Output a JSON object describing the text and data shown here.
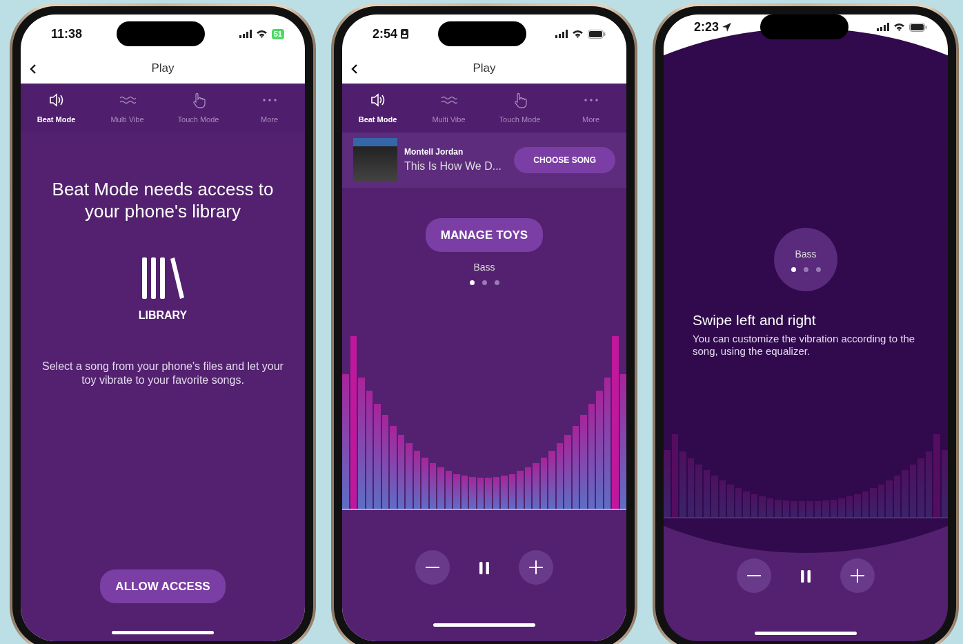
{
  "phones": [
    {
      "kind": "library-prompt",
      "status": {
        "time": "11:38",
        "battery": "51"
      },
      "nav": {
        "title": "Play"
      },
      "tabs": [
        {
          "label": "Beat Mode",
          "selected": true
        },
        {
          "label": "Multi Vibe",
          "selected": false
        },
        {
          "label": "Touch Mode",
          "selected": false
        },
        {
          "label": "More",
          "selected": false
        }
      ],
      "prompt": {
        "heading": "Beat Mode needs access to your phone's library",
        "icon_label": "LIBRARY",
        "text": "Select a song from your phone's files and let your toy vibrate to your favorite songs.",
        "button": "ALLOW ACCESS"
      }
    },
    {
      "kind": "player",
      "status": {
        "time": "2:54"
      },
      "nav": {
        "title": "Play"
      },
      "tabs": [
        {
          "label": "Beat Mode",
          "selected": true
        },
        {
          "label": "Multi Vibe",
          "selected": false
        },
        {
          "label": "Touch Mode",
          "selected": false
        },
        {
          "label": "More",
          "selected": false
        }
      ],
      "song": {
        "artist": "Montell Jordan",
        "title": "This Is How We D...",
        "button": "CHOOSE SONG"
      },
      "manage_button": "MANAGE TOYS",
      "preset": "Bass",
      "pages": [
        {
          "selected": true
        },
        {
          "selected": false
        },
        {
          "selected": false
        }
      ]
    },
    {
      "kind": "coach",
      "status": {
        "time": "2:23"
      },
      "preset": "Bass",
      "pages": [
        {
          "selected": true
        },
        {
          "selected": false
        },
        {
          "selected": false
        }
      ],
      "tip": {
        "title": "Swipe left and right",
        "text": "You can customize the vibration according to the song, using the equalizer."
      }
    }
  ]
}
